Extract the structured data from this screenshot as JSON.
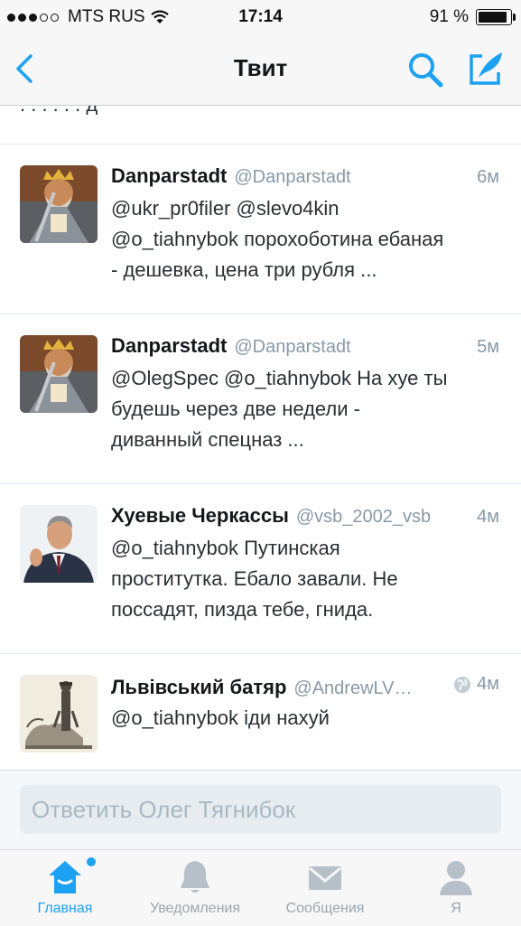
{
  "status": {
    "carrier": "MTS RUS",
    "time": "17:14",
    "battery": "91 %"
  },
  "nav": {
    "title": "Твит"
  },
  "tweets": [
    {
      "name": "Danparstadt",
      "handle": "@Danparstadt",
      "time": "6м",
      "lines": [
        "@ukr_pr0filer @slevo4kin",
        "@o_tiahnybok порохоботина ебаная",
        "- дешевка, цена три рубля ..."
      ]
    },
    {
      "name": "Danparstadt",
      "handle": "@Danparstadt",
      "time": "5м",
      "lines": [
        "@OlegSpec @o_tiahnybok На хуе ты",
        "будешь через две недели -",
        "диванный спецназ ..."
      ]
    },
    {
      "name": "Хуевые Черкассы",
      "handle": "@vsb_2002_vsb",
      "time": "4м",
      "lines": [
        "@o_tiahnybok Путинская",
        "проститутка. Ебало завали. Не",
        "поссадят, пизда тебе, гнида."
      ]
    },
    {
      "name": "Львівський батяр",
      "handle": "@AndrewLV…",
      "time": "4м",
      "lines": [
        "@o_tiahnybok іди нахуй"
      ]
    }
  ],
  "reply": {
    "placeholder": "Ответить Олег Тягнибок"
  },
  "tabs": [
    {
      "label": "Главная",
      "icon": "home-icon",
      "active": true
    },
    {
      "label": "Уведомления",
      "icon": "bell-icon"
    },
    {
      "label": "Сообщения",
      "icon": "envelope-icon"
    },
    {
      "label": "Я",
      "icon": "person-icon"
    }
  ],
  "colors": {
    "accent": "#1da1f2",
    "muted": "#8899a6"
  }
}
